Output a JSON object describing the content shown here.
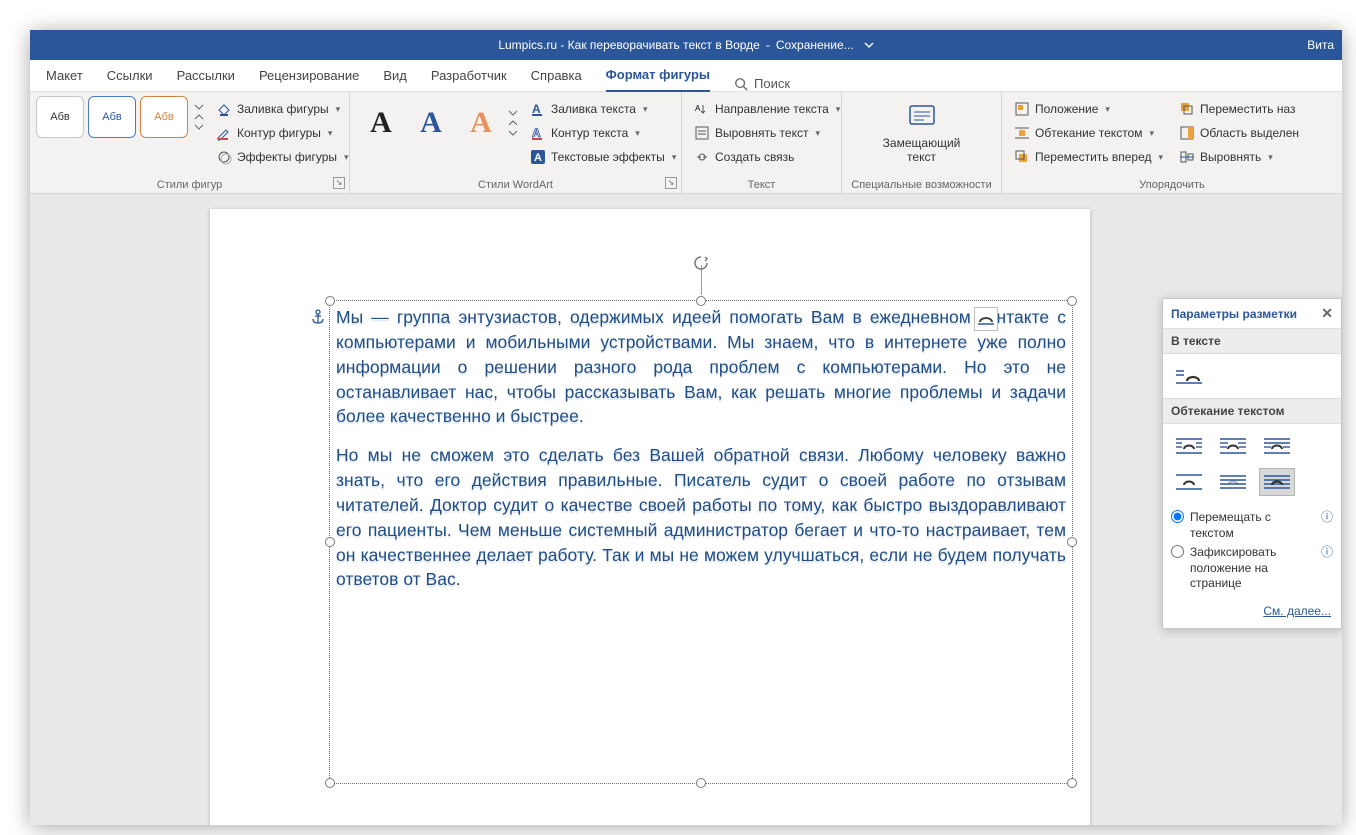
{
  "titlebar": {
    "doc": "Lumpics.ru - Как переворачивать текст в Ворде",
    "status": "Сохранение...",
    "user": "Вита"
  },
  "tabs": {
    "items": [
      "Макет",
      "Ссылки",
      "Рассылки",
      "Рецензирование",
      "Вид",
      "Разработчик",
      "Справка",
      "Формат фигуры"
    ],
    "active": 7,
    "search": "Поиск"
  },
  "ribbon": {
    "shapeStyles": {
      "label": "Стили фигур",
      "thumb": "Абв",
      "fill": "Заливка фигуры",
      "outline": "Контур фигуры",
      "effects": "Эффекты фигуры"
    },
    "wordart": {
      "label": "Стили WordArt",
      "textFill": "Заливка текста",
      "textOutline": "Контур текста",
      "textEffects": "Текстовые эффекты"
    },
    "text": {
      "label": "Текст",
      "direction": "Направление текста",
      "align": "Выровнять текст",
      "link": "Создать связь"
    },
    "access": {
      "label": "Специальные возможности",
      "alt": "Замещающий текст"
    },
    "arrange": {
      "label": "Упорядочить",
      "position": "Положение",
      "wrap": "Обтекание текстом",
      "forward": "Переместить вперед",
      "back": "Переместить наз",
      "selpane": "Область выделен",
      "alignBtn": "Выровнять"
    }
  },
  "doc": {
    "p1": "Мы — группа энтузиастов, одержимых идеей помогать Вам в ежедневном контакте с компьютерами и мобильными устройствами. Мы знаем, что в интернете уже полно информации о решении разного рода проблем с компьютерами. Но это не останавливает нас, чтобы рассказывать Вам, как решать многие проблемы и задачи более качественно и быстрее.",
    "p2": "Но мы не сможем это сделать без Вашей обратной связи. Любому человеку важно знать, что его действия правильные. Писатель судит о своей работе по отзывам читателей. Доктор судит о качестве своей работы по тому, как быстро выздоравливают его пациенты. Чем меньше системный администратор бегает и что-то настраивает, тем он качественнее делает работу. Так и мы не можем улучшаться, если не будем получать ответов от Вас."
  },
  "flyout": {
    "title": "Параметры разметки",
    "section1": "В тексте",
    "section2": "Обтекание текстом",
    "radio1": "Перемещать с текстом",
    "radio2": "Зафиксировать положение на странице",
    "more": "См. далее..."
  }
}
